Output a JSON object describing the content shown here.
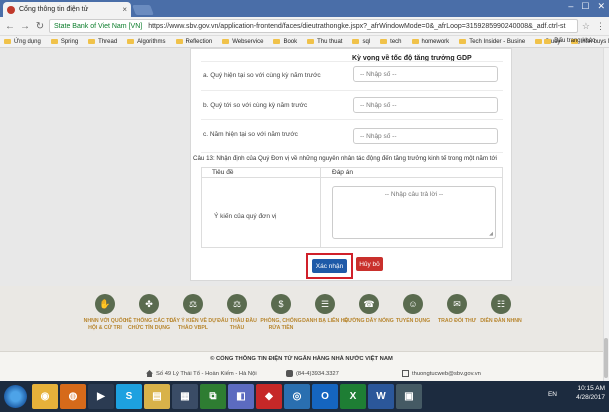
{
  "browser": {
    "tab_title": "Cổng thông tin điện tử",
    "tab_close": "×",
    "user_label": "—",
    "address": {
      "secure_label": "State Bank of Viet Nam [VN]",
      "url": "https://www.sbv.gov.vn/application-frontend/faces/dieutrathongke.jspx?_afrWindowMode=0&_afrLoop=3159285990240008&_adf.ctrl-st"
    },
    "bookmarks": [
      "Ứng dụng",
      "Spring",
      "Thread",
      "Algorithms",
      "Reflection",
      "Webservice",
      "Book",
      "Thu thuat",
      "sql",
      "tech",
      "homework",
      "Tech Insider - Busine",
      "Study",
      "Intel buys Mobileye i"
    ],
    "bookmarks_right": "Dấu trang khác"
  },
  "form": {
    "gdp_header": "Kỳ vọng về tốc độ tăng trưởng GDP",
    "rows": [
      {
        "label": "a. Quý hiện tại so với cùng kỳ năm trước",
        "placeholder": "-- Nhập số --"
      },
      {
        "label": "b. Quý tới so với cùng kỳ năm trước",
        "placeholder": "-- Nhập số --"
      },
      {
        "label": "c. Năm hiện tại so với năm trước",
        "placeholder": "-- Nhập số --"
      }
    ],
    "q13": "Câu 13: Nhận định của Quý Đơn vị về những nguyên nhân tác động đến tăng trưởng kinh tế trong một năm tới",
    "table": {
      "col1": "Tiêu đề",
      "col2": "Đáp án",
      "row_label": "Ý kiến của quý đơn vị",
      "textarea_placeholder": "-- Nhập câu trả lời --"
    },
    "confirm_label": "Xác nhận",
    "cancel_label": "Hủy bỏ"
  },
  "footer": {
    "links": [
      {
        "label": "NHNN VỚI QUỐC HỘI & CỬ TRI",
        "icon": "handshake-icon"
      },
      {
        "label": "HỆ THỐNG CÁC TỔ CHỨC TÍN DỤNG",
        "icon": "network-icon"
      },
      {
        "label": "LẤY Ý KIẾN VỀ DỰ THẢO VBPL",
        "icon": "gavel-icon"
      },
      {
        "label": "ĐẤU THẦU ĐẦU THẦU",
        "icon": "scales-icon"
      },
      {
        "label": "PHÒNG, CHỐNG RỬA TIỀN",
        "icon": "money-icon"
      },
      {
        "label": "DANH BẠ LIÊN HỆ",
        "icon": "phonebook-icon"
      },
      {
        "label": "ĐƯỜNG DÂY NÓNG",
        "icon": "phone-icon"
      },
      {
        "label": "TUYỂN DỤNG",
        "icon": "people-icon"
      },
      {
        "label": "TRAO ĐỔI THƯ",
        "icon": "mail-icon"
      },
      {
        "label": "DIỄN ĐÀN NHNN",
        "icon": "forum-icon"
      }
    ],
    "copyright": "© CỔNG THÔNG TIN ĐIỆN TỬ NGÂN HÀNG NHÀ NƯỚC VIỆT NAM",
    "address": "Số 49 Lý Thái Tổ - Hoàn Kiếm - Hà Nội",
    "phone": "(84-4)3934.3327",
    "email": "thuongtucweb@sbv.gov.vn"
  },
  "taskbar": {
    "lang": "EN",
    "time": "10:15 AM",
    "date": "4/28/2017"
  }
}
